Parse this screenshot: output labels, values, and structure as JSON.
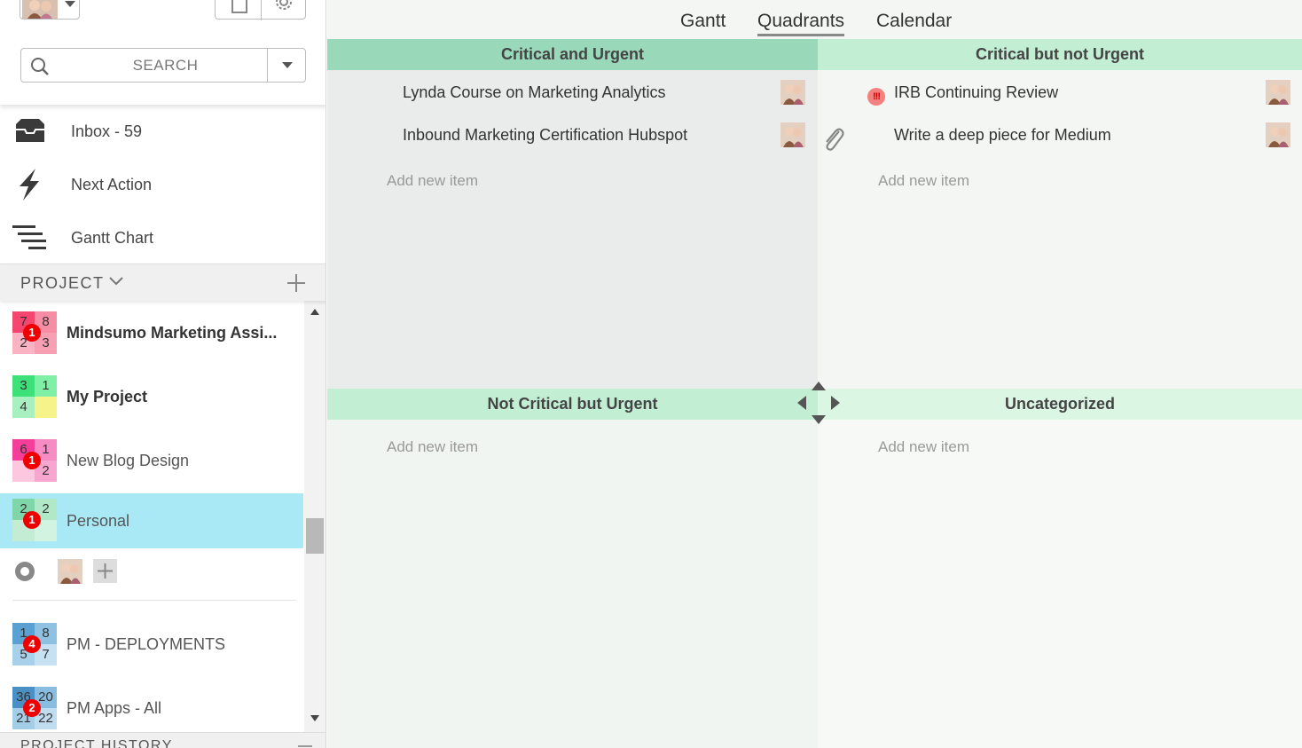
{
  "sidebar": {
    "search": {
      "placeholder": "SEARCH"
    },
    "nav": [
      {
        "label": "Inbox - 59",
        "icon": "inbox-icon"
      },
      {
        "label": "Next Action",
        "icon": "lightning-icon"
      },
      {
        "label": "Gantt Chart",
        "icon": "gantt-icon"
      }
    ],
    "project_header": "PROJECT",
    "projects": [
      {
        "name": "Mindsumo Marketing Assi...",
        "counts": [
          "7",
          "8",
          "2",
          "3"
        ],
        "badge": "1",
        "colors": [
          "#f4466e",
          "#f78da4",
          "#f9b3c2",
          "#f7a0b4"
        ]
      },
      {
        "name": "My Project",
        "counts": [
          "3",
          "1",
          "4",
          ""
        ],
        "badge": "",
        "colors": [
          "#3ee07a",
          "#7ff0a6",
          "#a9f0c0",
          "#f6f38a"
        ]
      },
      {
        "name": "New Blog Design",
        "counts": [
          "6",
          "1",
          "",
          "2"
        ],
        "badge": "1",
        "colors": [
          "#f43e9a",
          "#f78cc4",
          "#fbc8e0",
          "#f6a6cf"
        ]
      },
      {
        "name": "Personal",
        "counts": [
          "2",
          "2",
          "",
          ""
        ],
        "badge": "1",
        "colors": [
          "#7fd6a8",
          "#b1e8c8",
          "#c4ecd5",
          "#d3f3e1"
        ]
      },
      {
        "name": "PM - DEPLOYMENTS",
        "counts": [
          "1",
          "8",
          "5",
          "7"
        ],
        "badge": "4",
        "colors": [
          "#5aa0d0",
          "#8ec1e2",
          "#a8d0ea",
          "#c6e1f2"
        ]
      },
      {
        "name": "PM Apps - All",
        "counts": [
          "36",
          "20",
          "21",
          "22"
        ],
        "badge": "2",
        "colors": [
          "#4a90c4",
          "#88bde0",
          "#a4cde8",
          "#c0dcef"
        ]
      }
    ],
    "history_header": "PROJECT HISTORY"
  },
  "main": {
    "tabs": [
      "Gantt",
      "Quadrants",
      "Calendar"
    ],
    "active_tab": "Quadrants",
    "quadrants": [
      {
        "title": "Critical and Urgent",
        "header_color": "#99d9b9",
        "bg": "#e9ecea",
        "items": [
          "Lynda Course on Marketing Analytics",
          "Inbound Marketing Certification Hubspot"
        ],
        "add_label": "Add new item"
      },
      {
        "title": "Critical but not Urgent",
        "header_color": "#c2efd3",
        "bg": "#f4f6f4",
        "items": [
          "IRB Continuing Review",
          "Write a deep piece for Medium"
        ],
        "add_label": "Add new item"
      },
      {
        "title": "Not Critical but Urgent",
        "header_color": "#c2efd3",
        "bg": "#f1f5f2",
        "items": [],
        "add_label": "Add new item"
      },
      {
        "title": "Uncategorized",
        "header_color": "#dcf6e4",
        "bg": "#f7f9f7",
        "items": [],
        "add_label": "Add new item"
      }
    ],
    "flag_text": "!!!"
  }
}
